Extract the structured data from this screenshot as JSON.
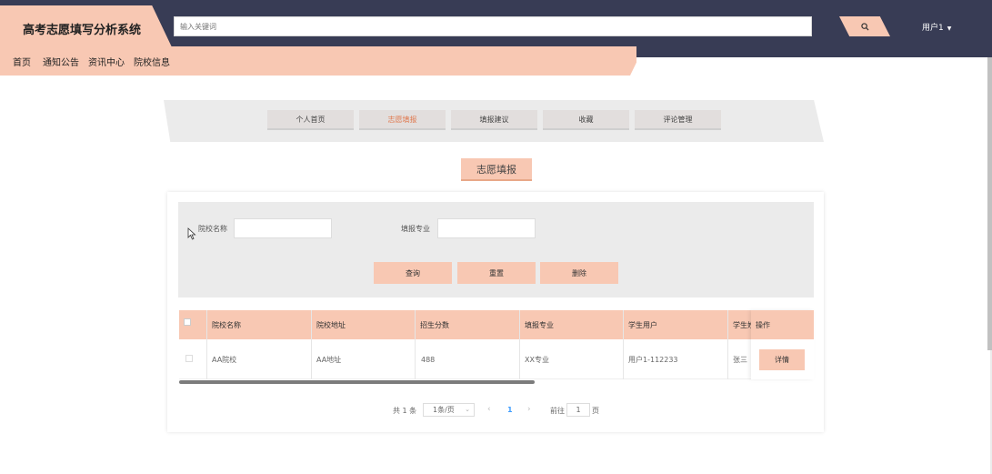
{
  "header": {
    "title": "高考志愿填写分析系统",
    "search_placeholder": "输入关键词",
    "user_label": "用户1"
  },
  "nav": {
    "items": [
      "首页",
      "通知公告",
      "资讯中心",
      "院校信息"
    ]
  },
  "tabs": {
    "items": [
      "个人首页",
      "志愿填报",
      "填报建议",
      "收藏",
      "评论管理"
    ],
    "active": "志愿填报"
  },
  "section_title": "志愿填报",
  "filters": {
    "school_label": "院校名称",
    "major_label": "填报专业"
  },
  "actions": {
    "query": "查询",
    "reset": "重置",
    "delete": "删除"
  },
  "table": {
    "columns": [
      "院校名称",
      "院校地址",
      "招生分数",
      "填报专业",
      "学生用户",
      "学生姓",
      "操作"
    ],
    "rows": [
      {
        "school": "AA院校",
        "address": "AA地址",
        "score": "488",
        "major": "XX专业",
        "user": "用户1-112233",
        "name": "张三",
        "op": "详情"
      }
    ]
  },
  "pagination": {
    "total": "共 1 条",
    "page_size": "1条/页",
    "current": "1",
    "goto_label": "前往",
    "goto_value": "1",
    "page_suffix": "页"
  },
  "colors": {
    "header_bg": "#383c55",
    "accent": "#f8c8b3",
    "active_tab": "#e0794f"
  }
}
